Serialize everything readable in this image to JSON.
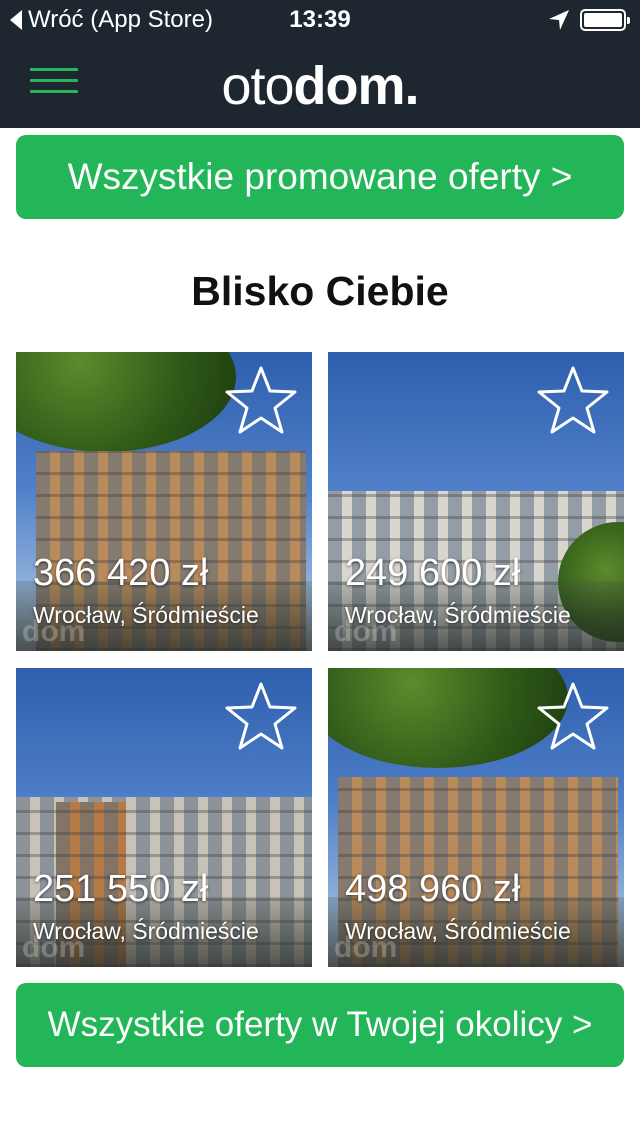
{
  "status_bar": {
    "back_label": "Wróć (App Store)",
    "time": "13:39",
    "icons": [
      "location-arrow-icon",
      "battery-icon"
    ]
  },
  "header": {
    "logo_light": "oto",
    "logo_bold": "dom.",
    "menu_icon": "hamburger-menu-icon",
    "background_color": "#1e2630",
    "accent_color": "#2bb55a"
  },
  "promoted_button_label": "Wszystkie promowane oferty >",
  "section_title": "Blisko Ciebie",
  "listings": [
    {
      "price": "366 420 zł",
      "location": "Wrocław, Śródmieście",
      "favorite_icon": "star-outline-icon"
    },
    {
      "price": "249 600 zł",
      "location": "Wrocław, Śródmieście",
      "favorite_icon": "star-outline-icon"
    },
    {
      "price": "251 550 zł",
      "location": "Wrocław, Śródmieście",
      "favorite_icon": "star-outline-icon"
    },
    {
      "price": "498 960 zł",
      "location": "Wrocław, Śródmieście",
      "favorite_icon": "star-outline-icon"
    }
  ],
  "nearby_button_label": "Wszystkie oferty w Twojej okolicy >",
  "colors": {
    "button_green": "#22b658",
    "title_text": "#111111"
  }
}
